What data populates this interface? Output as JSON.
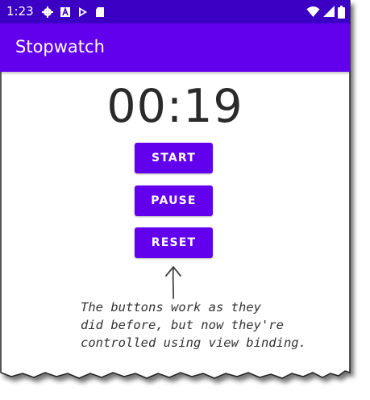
{
  "status_bar": {
    "time": "1:23",
    "left_icons": [
      "gear-icon",
      "a-icon",
      "play-store-icon",
      "sd-card-icon"
    ],
    "right_icons": [
      "wifi-icon",
      "signal-icon",
      "battery-icon"
    ],
    "background": "#3b00c4"
  },
  "app_bar": {
    "title": "Stopwatch",
    "background": "#6200ee"
  },
  "timer": {
    "value": "00:19"
  },
  "buttons": {
    "start_label": "START",
    "pause_label": "PAUSE",
    "reset_label": "RESET",
    "color": "#6200ee"
  },
  "annotation": {
    "lines": [
      "The buttons work as they",
      "did before, but now they're",
      "controlled using view binding."
    ]
  }
}
